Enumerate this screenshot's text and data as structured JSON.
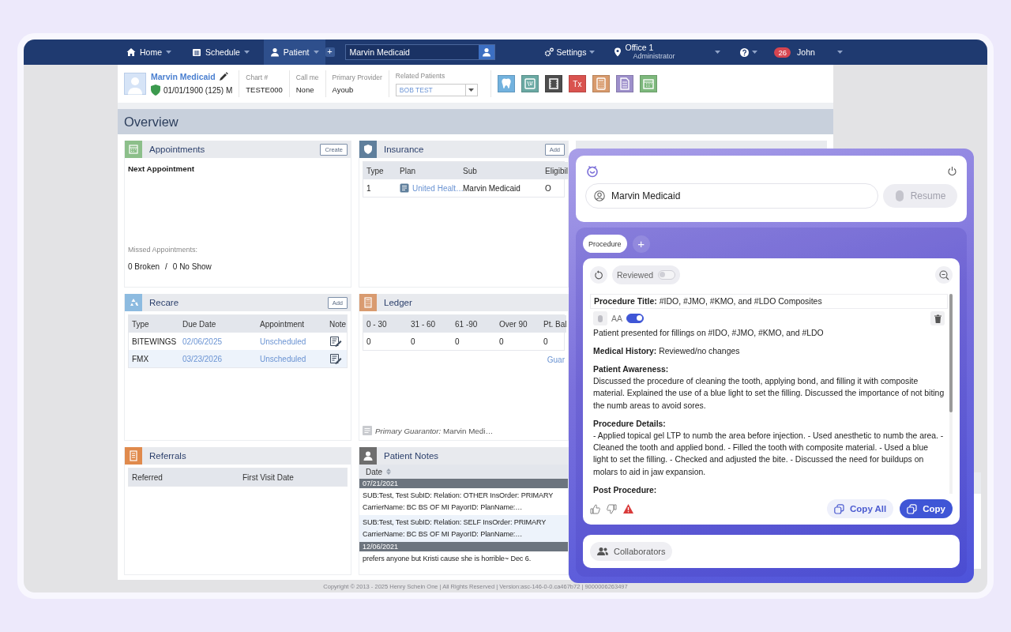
{
  "nav": {
    "tabs": [
      {
        "label": "Home",
        "selected": false
      },
      {
        "label": "Schedule",
        "selected": false
      },
      {
        "label": "Patient",
        "selected": true
      }
    ],
    "add": "+",
    "search": {
      "value": "Marvin Medicaid"
    },
    "settings": "Settings",
    "office": {
      "name": "Office 1",
      "role": "Administrator"
    },
    "badge": "26",
    "user": "John"
  },
  "patient": {
    "name": "Marvin Medicaid",
    "dob": "01/01/1900 (125) M",
    "fields": [
      {
        "label": "Chart #",
        "value": "TESTE000"
      },
      {
        "label": "Call me",
        "value": "None"
      },
      {
        "label": "Primary Provider",
        "value": "Ayoub"
      }
    ],
    "related": {
      "label": "Related Patients",
      "value": "BOB TEST"
    },
    "tools": [
      {
        "kind": "tooth",
        "color": "#72b2de"
      },
      {
        "kind": "xray",
        "color": "#6aa9a3"
      },
      {
        "kind": "film",
        "color": "#4d4d4d"
      },
      {
        "kind": "text",
        "label": "Tx",
        "color": "#d9534f"
      },
      {
        "kind": "calculator",
        "color": "#d89a6c"
      },
      {
        "kind": "document",
        "color": "#9d8fcb"
      },
      {
        "kind": "calendar",
        "color": "#7db87c"
      }
    ]
  },
  "overview": {
    "title": "Overview",
    "panels": [
      {
        "kind": "appointments",
        "title": "Appointments",
        "color": "#8cbf8a",
        "button": "Create",
        "next": "Next Appointment",
        "missed": "Missed Appointments:",
        "counts": [
          "0 Broken",
          "/",
          "0 No Show"
        ]
      },
      {
        "kind": "table",
        "title": "Insurance",
        "color": "#5f7f9c",
        "button": "Add",
        "columns": [
          "Type",
          "Plan",
          "Sub",
          "Eligibil"
        ],
        "rows": [
          [
            {
              "kind": "text",
              "text": "1"
            },
            {
              "kind": "doc-link",
              "text": "United Healt…"
            },
            {
              "kind": "text",
              "text": "Marvin Medicaid"
            },
            {
              "kind": "text",
              "text": "O"
            }
          ]
        ]
      },
      {
        "kind": "table",
        "title": "Recare",
        "color": "#8dbbe0",
        "button": "Add",
        "columns": [
          "Type",
          "Due Date",
          "Appointment",
          "Note"
        ],
        "rows": [
          [
            {
              "kind": "text",
              "text": "BITEWINGS"
            },
            {
              "kind": "link",
              "text": "02/06/2025"
            },
            {
              "kind": "link",
              "text": "Unscheduled"
            },
            {
              "kind": "note"
            }
          ],
          [
            {
              "kind": "text",
              "text": "FMX"
            },
            {
              "kind": "link",
              "text": "03/23/2026"
            },
            {
              "kind": "link",
              "text": "Unscheduled"
            },
            {
              "kind": "note"
            }
          ]
        ]
      },
      {
        "kind": "table",
        "title": "Ledger",
        "color": "#d99b70",
        "columns": [
          "0 - 30",
          "31 - 60",
          "61 -90",
          "Over 90",
          "Pt. Bal"
        ],
        "rows": [
          [
            {
              "kind": "text",
              "text": "0"
            },
            {
              "kind": "text",
              "text": "0"
            },
            {
              "kind": "text",
              "text": "0"
            },
            {
              "kind": "text",
              "text": "0"
            },
            {
              "kind": "text",
              "text": "0"
            }
          ]
        ],
        "link": "Guar",
        "footer": "*Primary Guarantor:*  Marvin Medi…"
      },
      {
        "kind": "table",
        "title": "Referrals",
        "color": "#e08a4c",
        "columns": [
          "Referred",
          "First Visit Date"
        ]
      },
      {
        "kind": "notes",
        "title": "Patient Notes",
        "color": "#6e6e6e",
        "column": "Date",
        "groups": [
          {
            "date": "07/21/2021",
            "notes": [
              "SUB:Test, Test SubID: Relation: OTHER InsOrder: PRIMARY CarrierName: BC BS OF MI PayorID: PlanName:…",
              "SUB:Test, Test SubID: Relation: SELF InsOrder: PRIMARY CarrierName: BC BS OF MI PayorID: PlanName:…"
            ]
          },
          {
            "date": "12/06/2021",
            "notes": [
              "prefers anyone but Kristi cause she is horrible~ Dec 6."
            ]
          }
        ]
      }
    ]
  },
  "assistant": {
    "patient": "Marvin Medicaid",
    "resume": {
      "label": "Resume",
      "disabled": true
    },
    "tabs": [
      {
        "label": "Procedure",
        "selected": true
      }
    ],
    "add_tab": "+",
    "reviewed": {
      "label": "Reviewed",
      "on": false
    },
    "title": "**Procedure Title:** #IDO, #JMO, #KMO, and #LDO Composites",
    "aa": {
      "label": "AA",
      "on": true
    },
    "blocks": [
      {
        "kind": "text",
        "text": "Patient presented for fillings on #IDO, #JMO, #KMO, and #LDO"
      },
      {
        "kind": "text",
        "text": "**Medical History:** Reviewed/no changes"
      },
      {
        "kind": "section",
        "heading": "Patient Awareness:",
        "text": "Discussed the procedure of cleaning the tooth, applying bond, and filling it with composite material. Explained the use of a blue light to set the filling. Discussed the importance of not biting the numb areas to avoid sores."
      },
      {
        "kind": "section",
        "heading": "Procedure Details:",
        "text": "- Applied topical gel LTP to numb the area before injection. - Used anesthetic to numb the area. - Cleaned the tooth and applied bond. - Filled the tooth with composite material. - Used a blue light to set the filling. - Checked and adjusted the bite. - Discussed the need for buildups on molars to aid in jaw expansion."
      },
      {
        "kind": "section",
        "heading": "Post Procedure:"
      }
    ],
    "actions": [
      {
        "label": "Copy All",
        "kind": "secondary"
      },
      {
        "label": "Copy",
        "kind": "primary"
      }
    ],
    "collaborators": "Collaborators"
  },
  "footer": "Copyright © 2013 - 2025 Henry Schein One | All Rights Reserved | Version:asc-146-0-0.ca467b72 | 9000006263497"
}
